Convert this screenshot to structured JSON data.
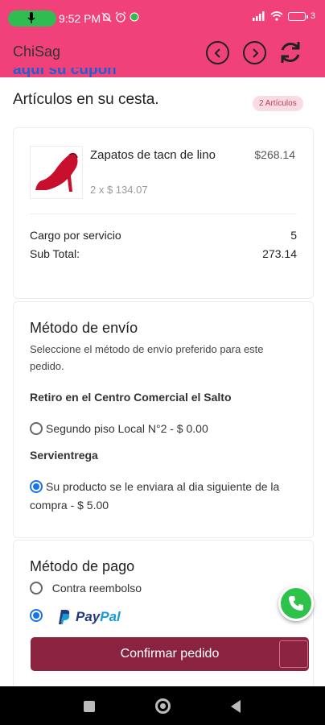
{
  "status_bar": {
    "time": "9:52 PM",
    "battery": "3",
    "icons": [
      "mic-icon",
      "mute-icon",
      "alarm-icon",
      "whatsapp-notification-icon",
      "signal-icon",
      "wifi-icon",
      "battery-icon"
    ]
  },
  "app_bar": {
    "title": "ChiSag",
    "icons": [
      "back-circle-icon",
      "forward-circle-icon",
      "refresh-icon"
    ]
  },
  "header": {
    "clipped_link": "aquí su cupón",
    "title": "Artículos en su cesta.",
    "badge": "2 Artículos"
  },
  "cart": {
    "item": {
      "name": "Zapatos de tacn de lino",
      "quantity_line": "2 x $ 134.07",
      "price": "$268.14"
    },
    "service_charge_label": "Cargo por servicio",
    "service_charge_value": "5",
    "subtotal_label": "Sub Total:",
    "subtotal_value": "273.14"
  },
  "shipping": {
    "title": "Método de envío",
    "description": "Seleccione el método de envío preferido para este pedido.",
    "group1_title": "Retiro en el Centro Comercial el Salto",
    "option1": "Segundo piso Local N°2 - $ 0.00",
    "option1_selected": false,
    "group2_title": "Servientrega",
    "option2": "Su producto se le enviara al dia siguiente de la compra - $ 5.00",
    "option2_selected": true
  },
  "payment": {
    "title": "Método de pago",
    "option1": "Contra reembolso",
    "option1_selected": false,
    "paypal_pay": "Pay",
    "paypal_pal": "Pal",
    "option2_selected": true,
    "confirm_label": "Confirmar pedido"
  },
  "colors": {
    "accent": "#f0417a",
    "confirm": "#8a2340",
    "link": "#1f5fcf",
    "radio": "#1a73e8"
  }
}
